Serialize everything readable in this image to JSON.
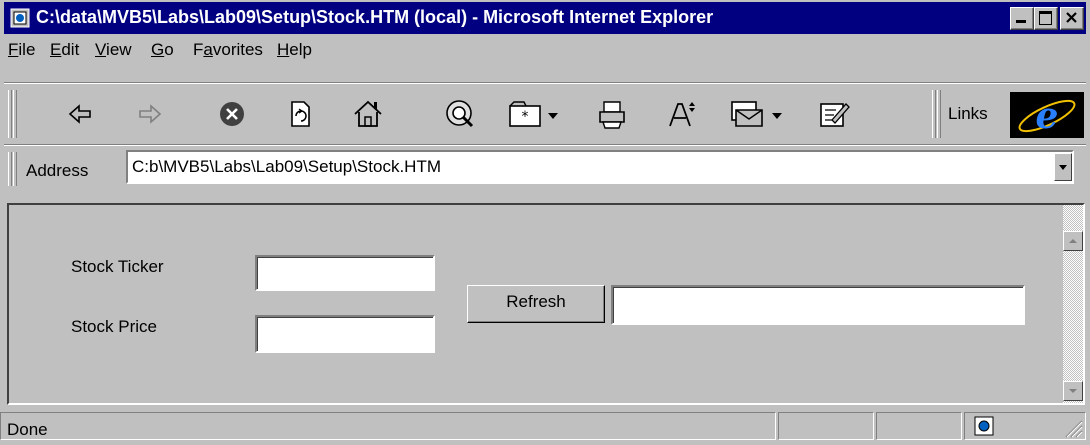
{
  "window": {
    "title": "C:\\data\\MVB5\\Labs\\Lab09\\Setup\\Stock.HTM (local) - Microsoft Internet Explorer",
    "icon": "ie-page-icon",
    "caption_buttons": [
      "minimize-icon",
      "maximize-icon",
      "close-icon"
    ]
  },
  "menu": {
    "file": "File",
    "edit": "Edit",
    "view": "View",
    "go": "Go",
    "favorites": "Favorites",
    "help": "Help"
  },
  "toolbar": {
    "icons": [
      "back-arrow-icon",
      "forward-arrow-icon",
      "stop-icon",
      "refresh-icon",
      "home-icon",
      "search-icon",
      "favorites-channel-icon",
      "print-icon",
      "font-size-icon",
      "mail-icon",
      "edit-icon"
    ],
    "links_label": "Links",
    "logo": "ie-logo-icon"
  },
  "address": {
    "label": "Address",
    "value": "C:b\\MVB5\\Labs\\Lab09\\Setup\\Stock.HTM"
  },
  "form": {
    "ticker_label": "Stock Ticker",
    "ticker_value": "",
    "price_label": "Stock Price",
    "price_value": "",
    "refresh_label": "Refresh",
    "result_value": ""
  },
  "status": {
    "text": "Done",
    "zone_icon": "local-zone-icon"
  }
}
